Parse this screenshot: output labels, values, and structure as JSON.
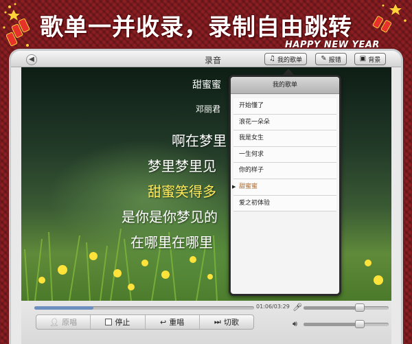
{
  "banner": {
    "title": "歌单一并收录，录制自由跳转",
    "subtitle": "HAPPY NEW YEAR"
  },
  "window": {
    "title": "录音",
    "back_icon": "arrow-left-icon"
  },
  "toolbar": {
    "my_songs": "我的歌单",
    "report_error": "报错",
    "background": "背景"
  },
  "song": {
    "name": "甜蜜蜜",
    "singer": "邓丽君"
  },
  "lyrics": [
    {
      "text": "啊在梦里",
      "active": false
    },
    {
      "text": "梦里梦里见",
      "active": false
    },
    {
      "text": "甜蜜笑得多",
      "active": true
    },
    {
      "text": "是你是你梦见的",
      "active": false
    },
    {
      "text": "在哪里在哪里",
      "active": false
    }
  ],
  "playlist": {
    "title": "我的歌单",
    "items": [
      "开始懂了",
      "浪花一朵朵",
      "我是女生",
      "一生何求",
      "你的样子",
      "甜蜜蜜",
      "爱之初体验"
    ],
    "selected_index": 5
  },
  "player": {
    "time": "01:06/03:29",
    "progress": 0.27,
    "mic_level": 0.66,
    "volume": 0.66
  },
  "controls": {
    "original": "原唱",
    "stop": "停止",
    "replay": "重唱",
    "switch": "切歌"
  },
  "colors": {
    "accent": "#b06a2c",
    "lyric_active": "#ffe95a",
    "banner_bg": "#8a1e22"
  }
}
